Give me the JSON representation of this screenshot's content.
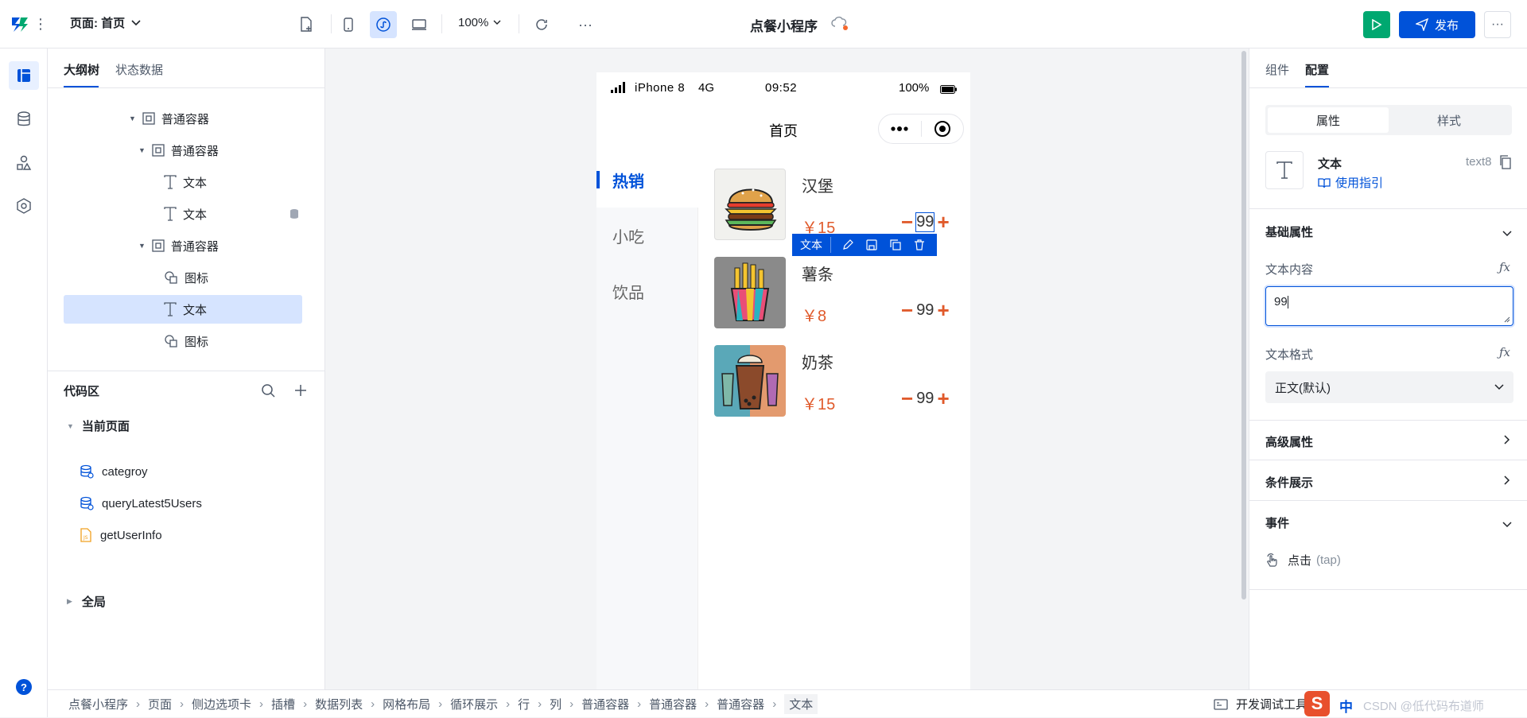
{
  "topbar": {
    "page_label": "页面: 首页",
    "zoom": "100%",
    "app_title": "点餐小程序",
    "publish_label": "发布"
  },
  "left_panel": {
    "tabs": [
      "大纲树",
      "状态数据"
    ],
    "tree": [
      {
        "label": "普通容器",
        "type": "container",
        "indent": 0,
        "arrow": true
      },
      {
        "label": "普通容器",
        "type": "container",
        "indent": 1,
        "arrow": true
      },
      {
        "label": "文本",
        "type": "text",
        "indent": 2,
        "arrow": false
      },
      {
        "label": "文本",
        "type": "text",
        "indent": 2,
        "arrow": false,
        "db": true
      },
      {
        "label": "普通容器",
        "type": "container",
        "indent": 1,
        "arrow": true
      },
      {
        "label": "图标",
        "type": "icon",
        "indent": 2,
        "arrow": false
      },
      {
        "label": "文本",
        "type": "text",
        "indent": 2,
        "arrow": false,
        "selected": true
      },
      {
        "label": "图标",
        "type": "icon",
        "indent": 2,
        "arrow": false
      }
    ],
    "code_area_title": "代码区",
    "current_page_label": "当前页面",
    "code_items": [
      {
        "label": "categroy",
        "kind": "db"
      },
      {
        "label": "queryLatest5Users",
        "kind": "db"
      },
      {
        "label": "getUserInfo",
        "kind": "js"
      }
    ],
    "global_label": "全局"
  },
  "phone": {
    "carrier": "iPhone 8",
    "network": "4G",
    "time": "09:52",
    "battery": "100%",
    "nav_title": "首页",
    "menu": [
      "热销",
      "小吃",
      "饮品"
    ],
    "foods": [
      {
        "name": "汉堡",
        "price": "￥15",
        "qty": "99"
      },
      {
        "name": "薯条",
        "price": "￥8",
        "qty": "99"
      },
      {
        "name": "奶茶",
        "price": "￥15",
        "qty": "99"
      }
    ],
    "selection_toolbar_label": "文本"
  },
  "right_panel": {
    "tabs": [
      "组件",
      "配置"
    ],
    "segment": [
      "属性",
      "样式"
    ],
    "component_name": "文本",
    "component_id": "text8",
    "guide_link": "使用指引",
    "basic_props_title": "基础属性",
    "text_content_label": "文本内容",
    "text_content_value": "99",
    "text_format_label": "文本格式",
    "text_format_value": "正文(默认)",
    "advanced_title": "高级属性",
    "condition_title": "条件展示",
    "events_title": "事件",
    "event_item": "点击",
    "event_item_sub": "(tap)"
  },
  "bottombar": {
    "breadcrumbs": [
      "点餐小程序",
      "页面",
      "侧边选项卡",
      "插槽",
      "数据列表",
      "网格布局",
      "循环展示",
      "行",
      "列",
      "普通容器",
      "普通容器",
      "普通容器",
      "文本"
    ],
    "devtools_label": "开发调试工具",
    "watermark": "CSDN @低代码布道师",
    "ime_label": "中"
  },
  "colors": {
    "primary": "#0052d9",
    "green": "#00a870",
    "price": "#e05a2b",
    "selected_bg": "#d6e4ff"
  }
}
